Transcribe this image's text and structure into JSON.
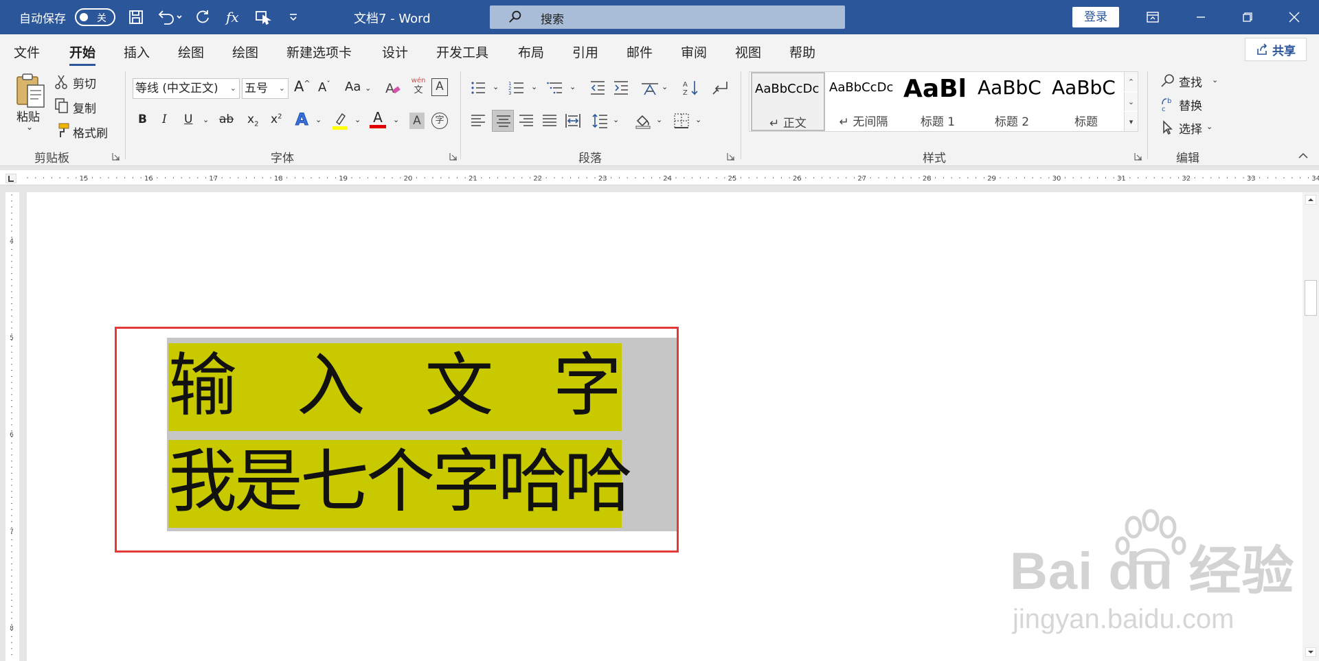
{
  "titlebar": {
    "autosave_label": "自动保存",
    "autosave_state": "关",
    "doc_title": "文档7  -  Word",
    "search_placeholder": "搜索",
    "login_label": "登录"
  },
  "tabs": [
    "文件",
    "开始",
    "插入",
    "绘图",
    "绘图",
    "新建选项卡",
    "设计",
    "开发工具",
    "布局",
    "引用",
    "邮件",
    "审阅",
    "视图",
    "帮助"
  ],
  "active_tab": "开始",
  "share_label": "共享",
  "clipboard": {
    "paste_label": "粘贴",
    "cut_label": "剪切",
    "copy_label": "复制",
    "format_painter_label": "格式刷",
    "group_label": "剪贴板"
  },
  "font": {
    "font_name": "等线 (中文正文)",
    "font_size": "五号",
    "grow_label": "A",
    "shrink_label": "A",
    "case_label": "Aa",
    "phonetic_top": "wén",
    "phonetic_bottom": "文",
    "border_char": "A",
    "bold": "B",
    "italic": "I",
    "underline": "U",
    "strike": "ab",
    "subscript": "x",
    "subscript_mark": "2",
    "superscript": "x",
    "superscript_mark": "2",
    "effects": "A",
    "highlight_color": "#ffff00",
    "font_color_char": "A",
    "font_color": "#e00000",
    "shading_char": "A",
    "enclose_char": "字",
    "group_label": "字体"
  },
  "paragraph": {
    "group_label": "段落"
  },
  "styles": {
    "items": [
      {
        "sample": "AaBbCcDc",
        "name": "正文"
      },
      {
        "sample": "AaBbCcDc",
        "name": "无间隔"
      },
      {
        "sample": "AaBl",
        "name": "标题 1"
      },
      {
        "sample": "AaBbC",
        "name": "标题 2"
      },
      {
        "sample": "AaBbC",
        "name": "标题"
      }
    ],
    "group_label": "样式"
  },
  "editing": {
    "find_label": "查找",
    "replace_label": "替换",
    "select_label": "选择",
    "group_label": "编辑"
  },
  "ruler": {
    "top_numbers": [
      "15",
      "16",
      "17",
      "18",
      "19",
      "20",
      "21",
      "22",
      "23",
      "24",
      "25",
      "26",
      "27",
      "28",
      "29",
      "30",
      "31",
      "32",
      "33",
      "34"
    ],
    "left_numbers": [
      "4",
      "5",
      "6",
      "7",
      "8"
    ]
  },
  "document": {
    "line1_chars": [
      "输",
      "入",
      "文",
      "字"
    ],
    "line2": "我是七个字哈哈",
    "highlight_color": "#c9c900",
    "frame_color": "#e53935"
  },
  "watermark": {
    "main": "Bai du 经验",
    "sub": "jingyan.baidu.com"
  },
  "colors": {
    "title_bar": "#2b579a",
    "ribbon_bg": "#f3f3f3"
  }
}
